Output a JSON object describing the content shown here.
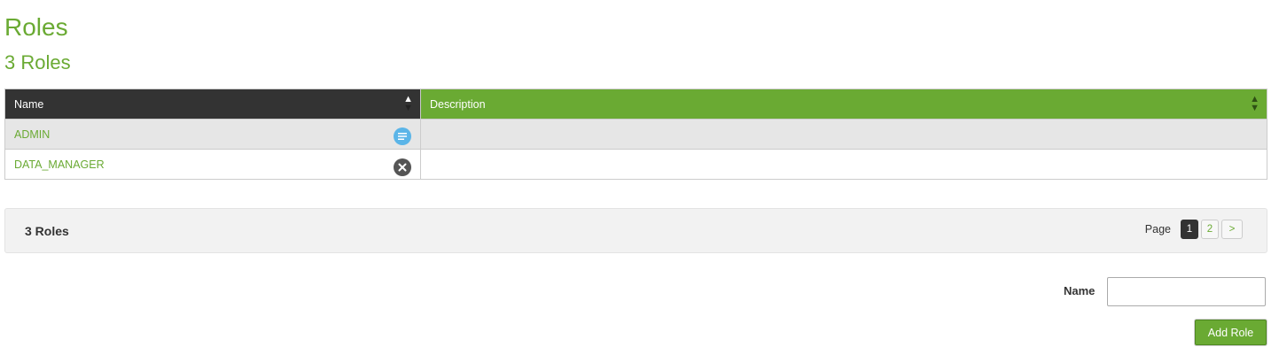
{
  "header": {
    "title": "Roles",
    "subtitle": "3 Roles"
  },
  "table": {
    "columns": [
      {
        "label": "Name",
        "sort": "ascending"
      },
      {
        "label": "Description",
        "sort": "none"
      }
    ],
    "rows": [
      {
        "name": "ADMIN",
        "description": "",
        "icon": "details-icon"
      },
      {
        "name": "DATA_MANAGER",
        "description": "",
        "icon": "delete-icon"
      }
    ]
  },
  "footer": {
    "count_label": "3 Roles",
    "page_label": "Page",
    "pages": [
      "1",
      "2"
    ],
    "current_page": "1",
    "next_label": ">"
  },
  "form": {
    "name_label": "Name",
    "name_value": "",
    "name_placeholder": "",
    "add_button_label": "Add Role"
  },
  "colors": {
    "accent": "#6aaa33",
    "header_dark": "#333333",
    "details_icon": "#5bb5e8",
    "delete_icon": "#555555"
  }
}
